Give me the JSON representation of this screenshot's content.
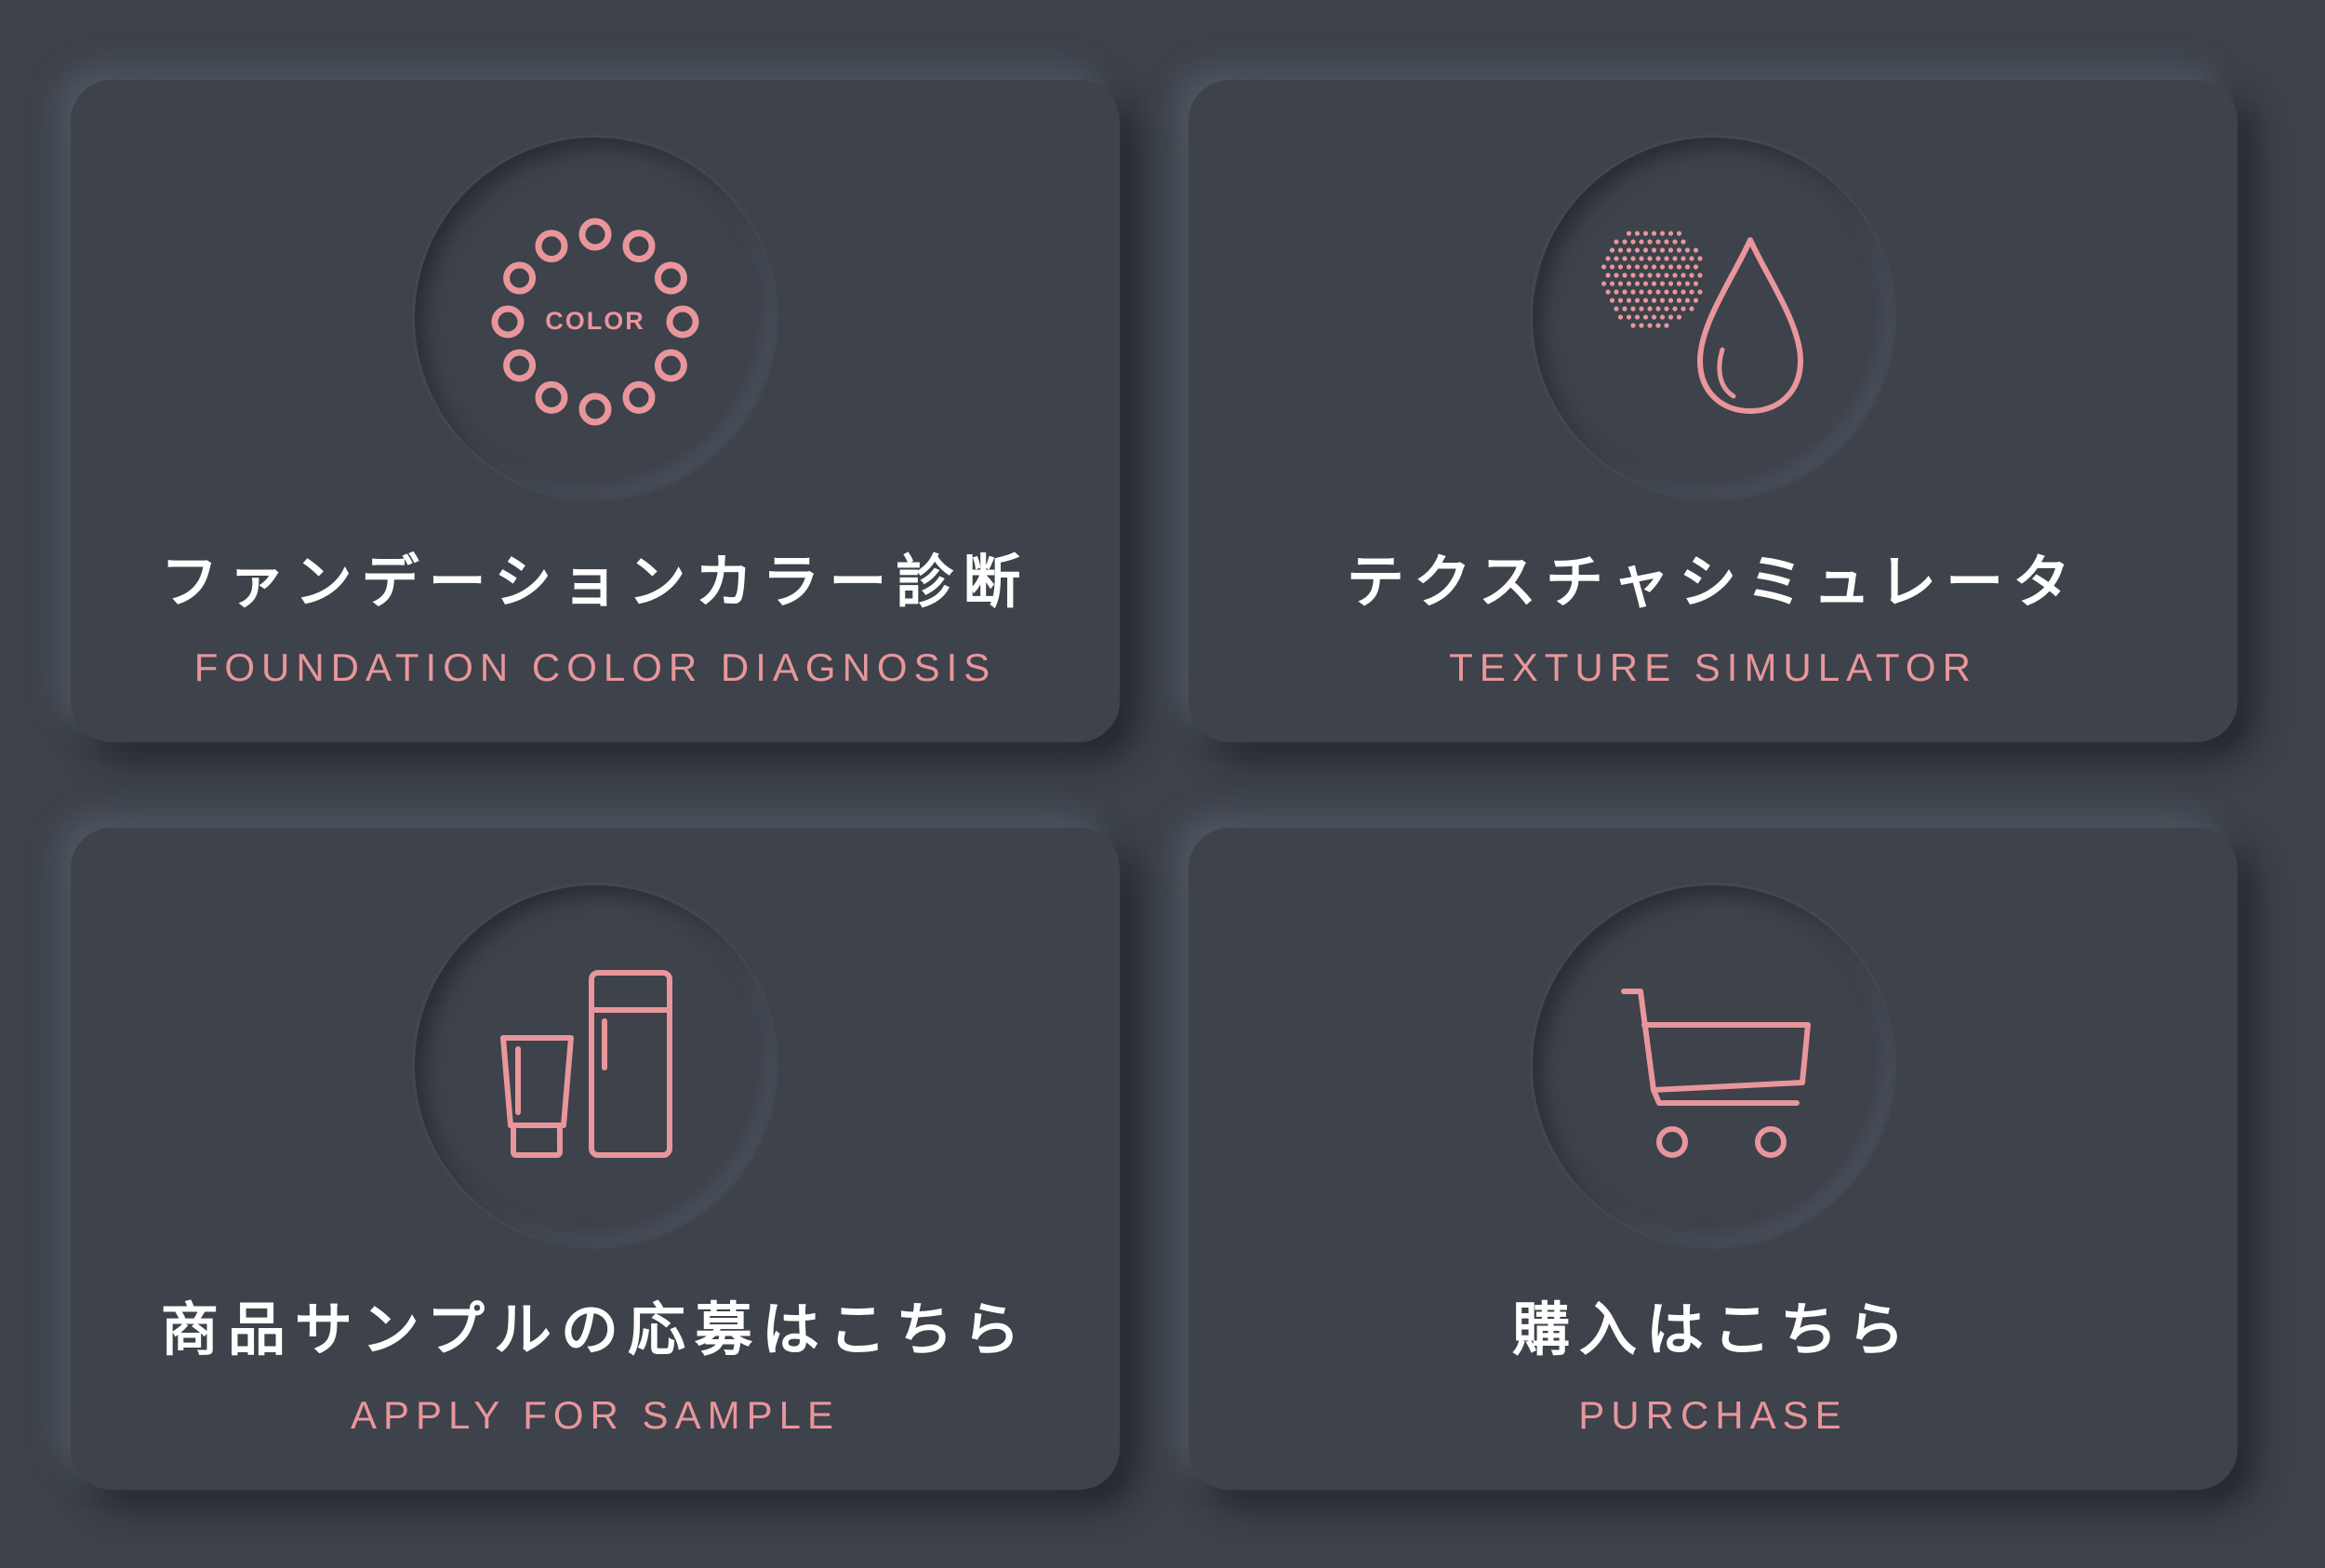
{
  "colors": {
    "background": "#3d424b",
    "accent": "#e8969b",
    "title": "#ffffff"
  },
  "cards": [
    {
      "icon": "color-palette-icon",
      "icon_text": "COLOR",
      "title_jp": "ファンデーションカラー診断",
      "title_en": "FOUNDATION COLOR DIAGNOSIS"
    },
    {
      "icon": "texture-drop-icon",
      "title_jp": "テクスチャシミュレータ",
      "title_en": "TEXTURE SIMULATOR"
    },
    {
      "icon": "cosmetic-products-icon",
      "title_jp": "商品サンプルの応募はこちら",
      "title_en": "APPLY FOR SAMPLE"
    },
    {
      "icon": "shopping-cart-icon",
      "title_jp": "購入はこちら",
      "title_en": "PURCHASE"
    }
  ]
}
